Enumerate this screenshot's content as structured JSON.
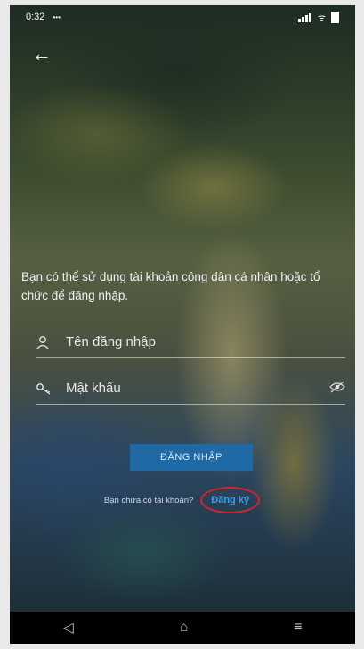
{
  "status_bar": {
    "time": "0:32",
    "dots": "•••",
    "battery_icon": "battery-icon",
    "signal_icon": "signal-icon",
    "wifi_icon": "wifi-icon"
  },
  "header": {
    "back_icon": "back-arrow-icon"
  },
  "intro_text": "Bạn có thể sử dụng tài khoản công dân cá nhân hoặc tổ chức để đăng nhập.",
  "form": {
    "username_placeholder": "Tên đăng nhập",
    "password_placeholder": "Mật khẩu",
    "login_label": "ĐĂNG NHẬP"
  },
  "signup": {
    "prompt": "Bạn chưa có tài khoản?",
    "link_label": "Đăng ký"
  },
  "colors": {
    "button_bg": "#1f6aa5",
    "link": "#3b9de0",
    "highlight_circle": "#d8222a"
  },
  "nav": {
    "back": "◁",
    "home": "⌂",
    "menu": "≡"
  }
}
